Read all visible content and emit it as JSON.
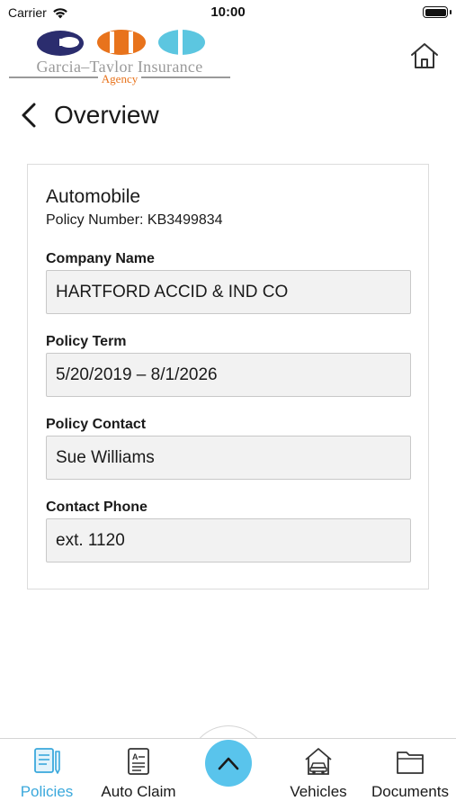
{
  "status_bar": {
    "carrier": "Carrier",
    "time": "10:00"
  },
  "header": {
    "logo_name": "Garcia–Taylor Insurance",
    "logo_sub": "Agency",
    "brand_colors": {
      "navy": "#2b2d6e",
      "orange": "#e8731c",
      "teal": "#5cc6e0",
      "gray": "#9a9a9a"
    }
  },
  "page": {
    "title": "Overview"
  },
  "policy": {
    "type": "Automobile",
    "number_text": "Policy Number: KB3499834",
    "fields": [
      {
        "label": "Company Name",
        "value": "HARTFORD ACCID & IND CO"
      },
      {
        "label": "Policy Term",
        "value": "5/20/2019 – 8/1/2026"
      },
      {
        "label": "Policy Contact",
        "value": "Sue Williams"
      },
      {
        "label": "Contact Phone",
        "value": "ext. 1120"
      }
    ]
  },
  "tab_bar": {
    "accent": "#3aa8dc",
    "fab_color": "#59c4ec",
    "tabs": [
      {
        "label": "Policies",
        "icon": "policies-icon",
        "active": true
      },
      {
        "label": "Auto Claim",
        "icon": "auto-claim-icon",
        "active": false
      },
      {
        "label": "Vehicles",
        "icon": "vehicles-icon",
        "active": false
      },
      {
        "label": "Documents",
        "icon": "documents-icon",
        "active": false
      }
    ]
  }
}
